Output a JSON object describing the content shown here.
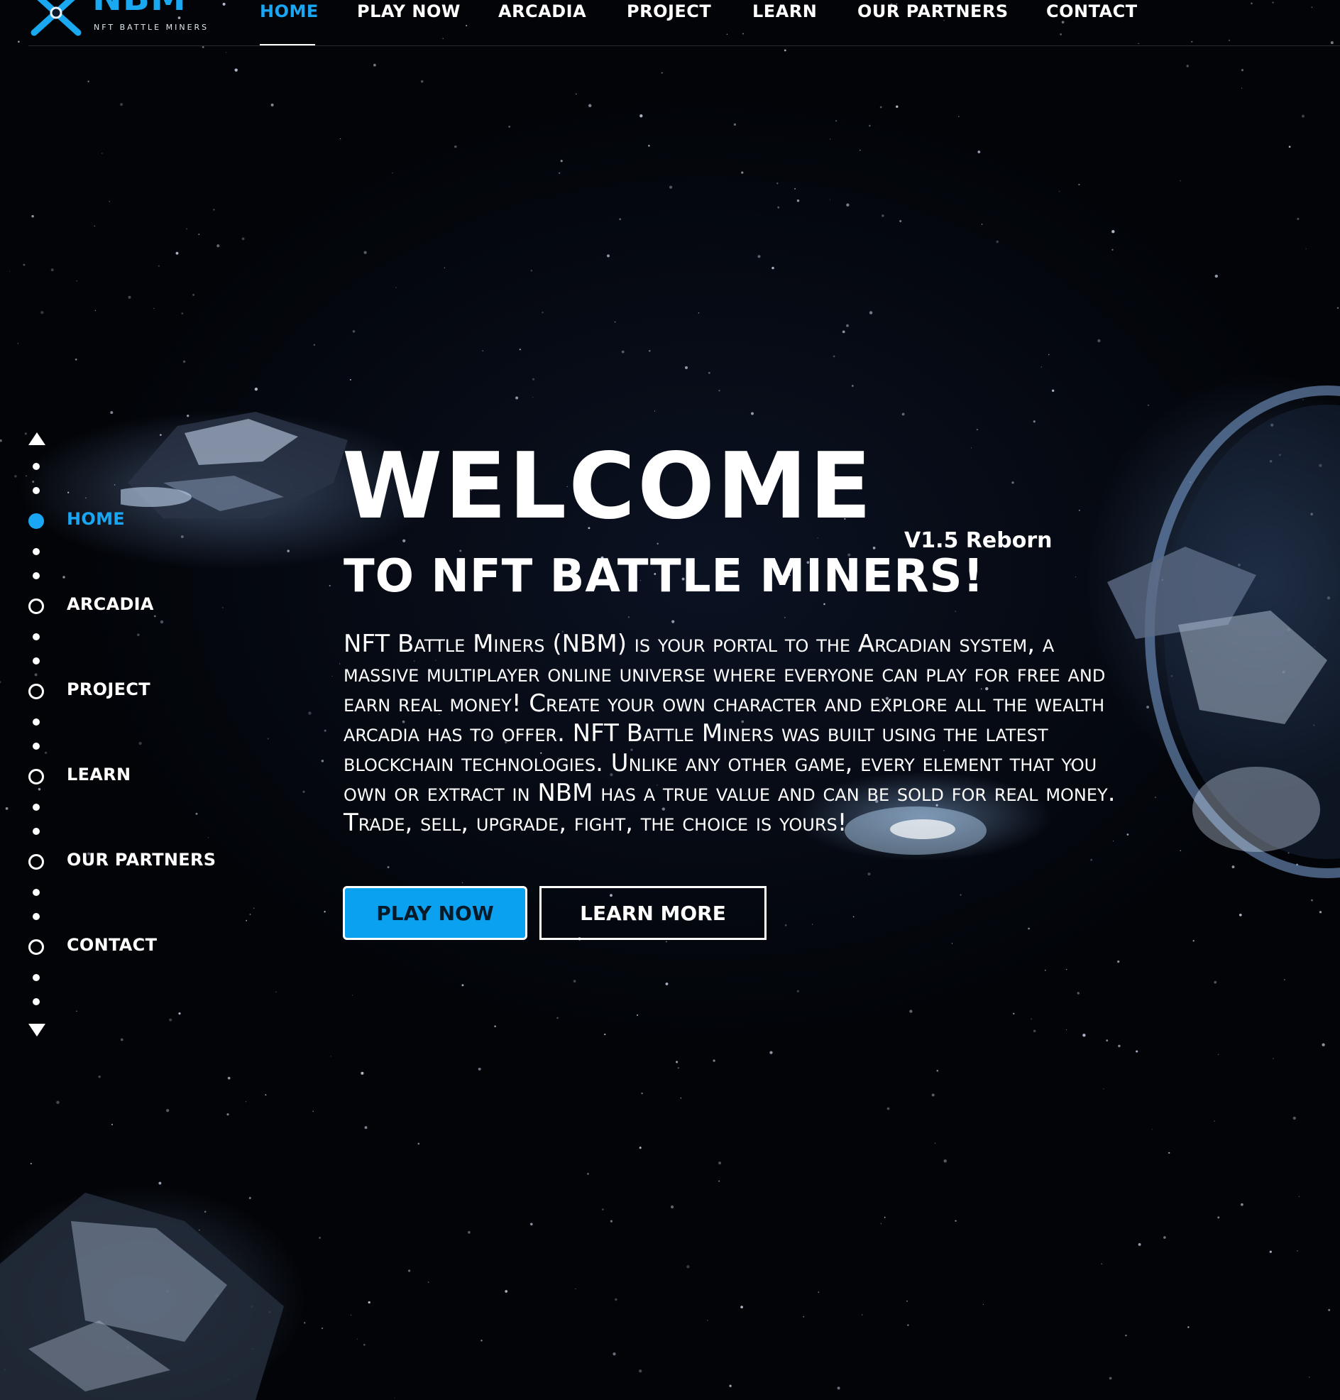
{
  "brand": {
    "logo_text": "NBM",
    "logo_subtitle": "NFT BATTLE MINERS",
    "accent_color": "#19a6f2"
  },
  "top_nav": {
    "items": [
      {
        "label": "HOME",
        "active": true
      },
      {
        "label": "PLAY NOW",
        "active": false
      },
      {
        "label": "ARCADIA",
        "active": false
      },
      {
        "label": "PROJECT",
        "active": false
      },
      {
        "label": "LEARN",
        "active": false
      },
      {
        "label": "OUR PARTNERS",
        "active": false
      },
      {
        "label": "CONTACT",
        "active": false
      }
    ]
  },
  "side_nav": {
    "items": [
      {
        "label": "HOME",
        "active": true
      },
      {
        "label": "ARCADIA",
        "active": false
      },
      {
        "label": "PROJECT",
        "active": false
      },
      {
        "label": "LEARN",
        "active": false
      },
      {
        "label": "OUR PARTNERS",
        "active": false
      },
      {
        "label": "CONTACT",
        "active": false
      }
    ],
    "icons": {
      "up": "triangle-up-icon",
      "down": "triangle-down-icon"
    }
  },
  "hero": {
    "title": "WELCOME",
    "subtitle": "TO NFT BATTLE MINERS!",
    "version": "V1.5 Reborn",
    "description": "NFT Battle Miners (NBM) is your portal to the Arcadian system, a massive multiplayer online universe where everyone can play for free and earn real money! Create your own character and explore all the wealth arcadia has to offer. NFT Battle Miners was built using the latest blockchain technologies. Unlike any other game, every element that you own or extract in NBM has a true value and can be sold for real money. Trade, sell, upgrade, fight, the choice is yours!",
    "play_button": "PLAY NOW",
    "learn_button": "LEARN MORE"
  }
}
